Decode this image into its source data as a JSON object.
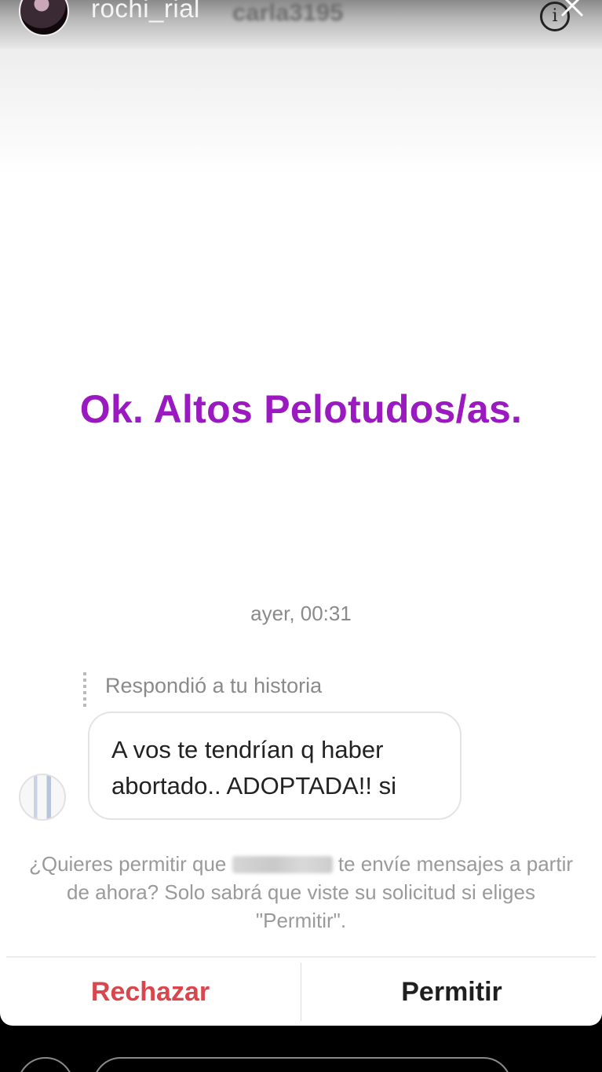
{
  "story_header": {
    "username": "rochi_rial",
    "viewer_name_blurred": "carla3195",
    "info_icon": "info-icon",
    "close_icon": "close-icon"
  },
  "story": {
    "text": "Ok. Altos Pelotudos/as.",
    "text_color": "#9b19c0"
  },
  "message": {
    "timestamp": "ayer, 00:31",
    "reply_label": "Respondió a tu historia",
    "bubble_line1": "A vos te tendrían q haber",
    "bubble_line2": "abortado.. ADOPTADA!! si"
  },
  "permission": {
    "text_before": "¿Quieres permitir que ",
    "text_after": " te envíe mensajes a partir de ahora? Solo sabrá que viste su solicitud si eliges \"Permitir\"."
  },
  "actions": {
    "reject_label": "Rechazar",
    "allow_label": "Permitir",
    "reject_color": "#d9464b"
  }
}
